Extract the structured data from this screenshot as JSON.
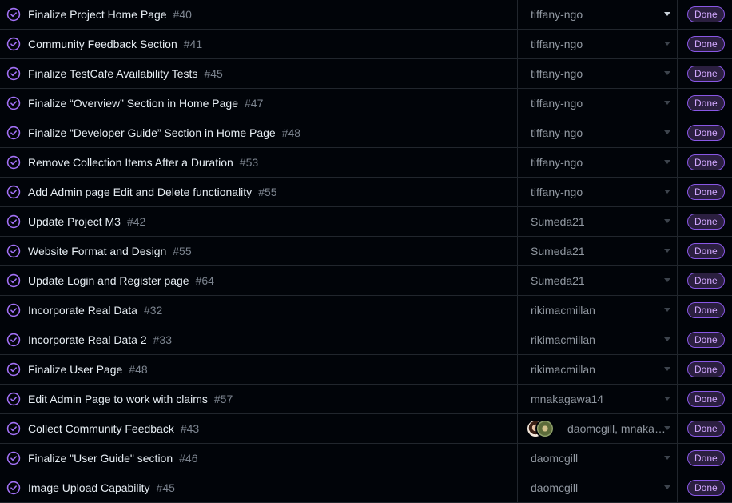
{
  "rows": [
    {
      "title": "Finalize Project Home Page",
      "number": "#40",
      "assignee": "tiffany-ngo",
      "avatars": [
        "tiffany"
      ],
      "status": "Done",
      "caret_active": true
    },
    {
      "title": "Community Feedback Section",
      "number": "#41",
      "assignee": "tiffany-ngo",
      "avatars": [
        "tiffany"
      ],
      "status": "Done",
      "caret_active": false
    },
    {
      "title": "Finalize TestCafe Availability Tests",
      "number": "#45",
      "assignee": "tiffany-ngo",
      "avatars": [
        "tiffany"
      ],
      "status": "Done",
      "caret_active": false
    },
    {
      "title": "Finalize “Overview” Section in Home Page",
      "number": "#47",
      "assignee": "tiffany-ngo",
      "avatars": [
        "tiffany"
      ],
      "status": "Done",
      "caret_active": false
    },
    {
      "title": "Finalize “Developer Guide” Section in Home Page",
      "number": "#48",
      "assignee": "tiffany-ngo",
      "avatars": [
        "tiffany"
      ],
      "status": "Done",
      "caret_active": false
    },
    {
      "title": "Remove Collection Items After a Duration",
      "number": "#53",
      "assignee": "tiffany-ngo",
      "avatars": [
        "tiffany"
      ],
      "status": "Done",
      "caret_active": false
    },
    {
      "title": "Add Admin page Edit and Delete functionality",
      "number": "#55",
      "assignee": "tiffany-ngo",
      "avatars": [
        "tiffany"
      ],
      "status": "Done",
      "caret_active": false
    },
    {
      "title": "Update Project M3",
      "number": "#42",
      "assignee": "Sumeda21",
      "avatars": [
        "sumeda"
      ],
      "status": "Done",
      "caret_active": false
    },
    {
      "title": "Website Format and Design",
      "number": "#55",
      "assignee": "Sumeda21",
      "avatars": [
        "sumeda"
      ],
      "status": "Done",
      "caret_active": false
    },
    {
      "title": "Update Login and Register page",
      "number": "#64",
      "assignee": "Sumeda21",
      "avatars": [
        "sumeda"
      ],
      "status": "Done",
      "caret_active": false
    },
    {
      "title": "Incorporate Real Data",
      "number": "#32",
      "assignee": "rikimacmillan",
      "avatars": [
        "riki"
      ],
      "status": "Done",
      "caret_active": false
    },
    {
      "title": "Incorporate Real Data 2",
      "number": "#33",
      "assignee": "rikimacmillan",
      "avatars": [
        "riki"
      ],
      "status": "Done",
      "caret_active": false
    },
    {
      "title": "Finalize User Page",
      "number": "#48",
      "assignee": "rikimacmillan",
      "avatars": [
        "riki"
      ],
      "status": "Done",
      "caret_active": false
    },
    {
      "title": "Edit Admin Page to work with claims",
      "number": "#57",
      "assignee": "mnakagawa14",
      "avatars": [
        "mnak"
      ],
      "status": "Done",
      "caret_active": false
    },
    {
      "title": "Collect Community Feedback",
      "number": "#43",
      "assignee": "daomcgill, mnakag...",
      "avatars": [
        "dao",
        "mnak"
      ],
      "status": "Done",
      "caret_active": false
    },
    {
      "title": "Finalize \"User Guide\" section",
      "number": "#46",
      "assignee": "daomcgill",
      "avatars": [
        "dao"
      ],
      "status": "Done",
      "caret_active": false
    },
    {
      "title": "Image Upload Capability",
      "number": "#45",
      "assignee": "daomcgill",
      "avatars": [
        "dao"
      ],
      "status": "Done",
      "caret_active": false
    }
  ],
  "icons": {
    "status": "closed-issue-check-icon",
    "caret": "caret-down-icon"
  },
  "colors": {
    "background": "#010409",
    "border": "#21262d",
    "done_purple": "#8957e5",
    "done_text": "#d2a8ff"
  }
}
